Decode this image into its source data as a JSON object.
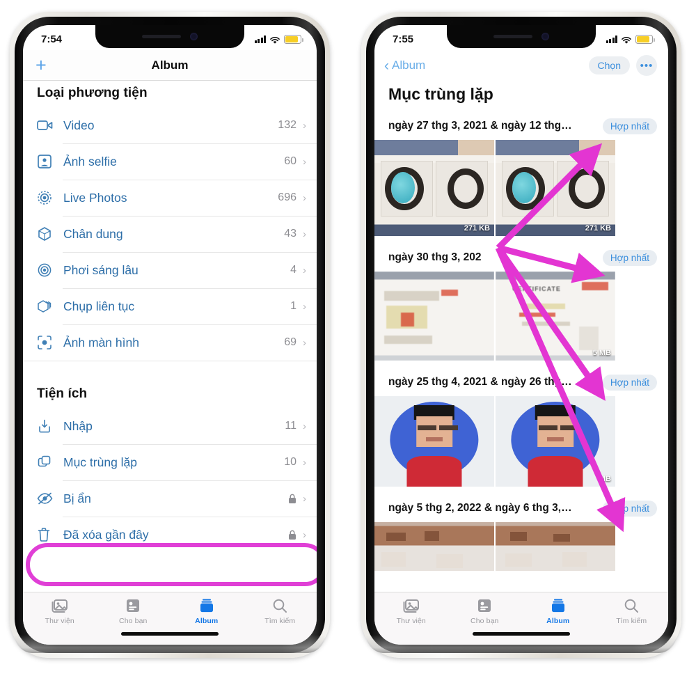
{
  "left_phone": {
    "status": {
      "time": "7:54",
      "signal_icon": "cellular-bars-icon",
      "wifi_icon": "wifi-icon",
      "battery_icon": "battery-icon"
    },
    "nav": {
      "add_label": "+",
      "title": "Album"
    },
    "sections": [
      {
        "header": "Loại phương tiện",
        "rows": [
          {
            "icon": "video-icon",
            "label": "Video",
            "count": "132",
            "chevron": "›"
          },
          {
            "icon": "selfie-icon",
            "label": "Ảnh selfie",
            "count": "60",
            "chevron": "›"
          },
          {
            "icon": "live-photo-icon",
            "label": "Live Photos",
            "count": "696",
            "chevron": "›"
          },
          {
            "icon": "portrait-icon",
            "label": "Chân dung",
            "count": "43",
            "chevron": "›"
          },
          {
            "icon": "long-exposure-icon",
            "label": "Phơi sáng lâu",
            "count": "4",
            "chevron": "›"
          },
          {
            "icon": "burst-icon",
            "label": "Chụp liên tục",
            "count": "1",
            "chevron": "›"
          },
          {
            "icon": "screenshot-icon",
            "label": "Ảnh màn hình",
            "count": "69",
            "chevron": "›"
          }
        ]
      },
      {
        "header": "Tiện ích",
        "rows": [
          {
            "icon": "import-icon",
            "label": "Nhập",
            "count": "11",
            "chevron": "›"
          },
          {
            "icon": "duplicates-icon",
            "label": "Mục trùng lặp",
            "count": "10",
            "chevron": "›",
            "highlighted": true
          },
          {
            "icon": "hidden-icon",
            "label": "Bị ẩn",
            "count": "",
            "locked": true,
            "chevron": "›"
          },
          {
            "icon": "trash-icon",
            "label": "Đã xóa gần đây",
            "count": "",
            "locked": true,
            "chevron": "›"
          }
        ]
      }
    ],
    "tabs": [
      {
        "icon": "library-icon",
        "label": "Thư viện",
        "active": false
      },
      {
        "icon": "foryou-icon",
        "label": "Cho bạn",
        "active": false
      },
      {
        "icon": "albums-icon",
        "label": "Album",
        "active": true
      },
      {
        "icon": "search-icon",
        "label": "Tìm kiếm",
        "active": false
      }
    ]
  },
  "right_phone": {
    "status": {
      "time": "7:55",
      "signal_icon": "cellular-bars-icon",
      "wifi_icon": "wifi-icon",
      "battery_icon": "battery-icon"
    },
    "nav": {
      "back_icon": "chevron-left-icon",
      "back_label": "Album",
      "select_label": "Chọn",
      "more_icon": "more-dots-icon",
      "more_label": "•••"
    },
    "title": "Mục trùng lặp",
    "groups": [
      {
        "date": "ngày 27 thg 3, 2021 & ngày 12 thg…",
        "merge_label": "Hợp nhất",
        "art": "jewelry",
        "thumbs": [
          {
            "size": "271 KB"
          },
          {
            "size": "271 KB"
          }
        ]
      },
      {
        "date": "ngày 30 thg 3, 202",
        "merge_label": "Hợp nhất",
        "art": "certificate",
        "thumbs": [
          {
            "size": ""
          },
          {
            "size": "5 MB"
          }
        ]
      },
      {
        "date": "ngày 25 thg 4, 2021 & ngày 26 thg…",
        "merge_label": "Hợp nhất",
        "art": "face",
        "thumbs": [
          {
            "size": ""
          },
          {
            "size": "MB"
          }
        ]
      },
      {
        "date": "ngày 5 thg 2, 2022 & ngày 6 thg 3,…",
        "merge_label": "Hợp nhất",
        "art": "crowd",
        "thumbs": [
          {
            "size": ""
          },
          {
            "size": ""
          }
        ]
      }
    ],
    "tabs": [
      {
        "icon": "library-icon",
        "label": "Thư viện",
        "active": false
      },
      {
        "icon": "foryou-icon",
        "label": "Cho bạn",
        "active": false
      },
      {
        "icon": "albums-icon",
        "label": "Album",
        "active": true
      },
      {
        "icon": "search-icon",
        "label": "Tìm kiếm",
        "active": false
      }
    ]
  },
  "annotations": {
    "highlight_color": "#e03fd6",
    "arrow_color": "#e335d2",
    "highlight_target": "Mục trùng lặp",
    "arrow_targets": [
      "Hợp nhất",
      "Hợp nhất",
      "Hợp nhất",
      "Hợp nhất"
    ]
  },
  "colors": {
    "accent_blue": "#1477e6",
    "link_blue": "#3c8fdd",
    "row_label_blue": "#2d6ea8",
    "magenta": "#e03fd6",
    "battery_yellow": "#f7ce25"
  }
}
